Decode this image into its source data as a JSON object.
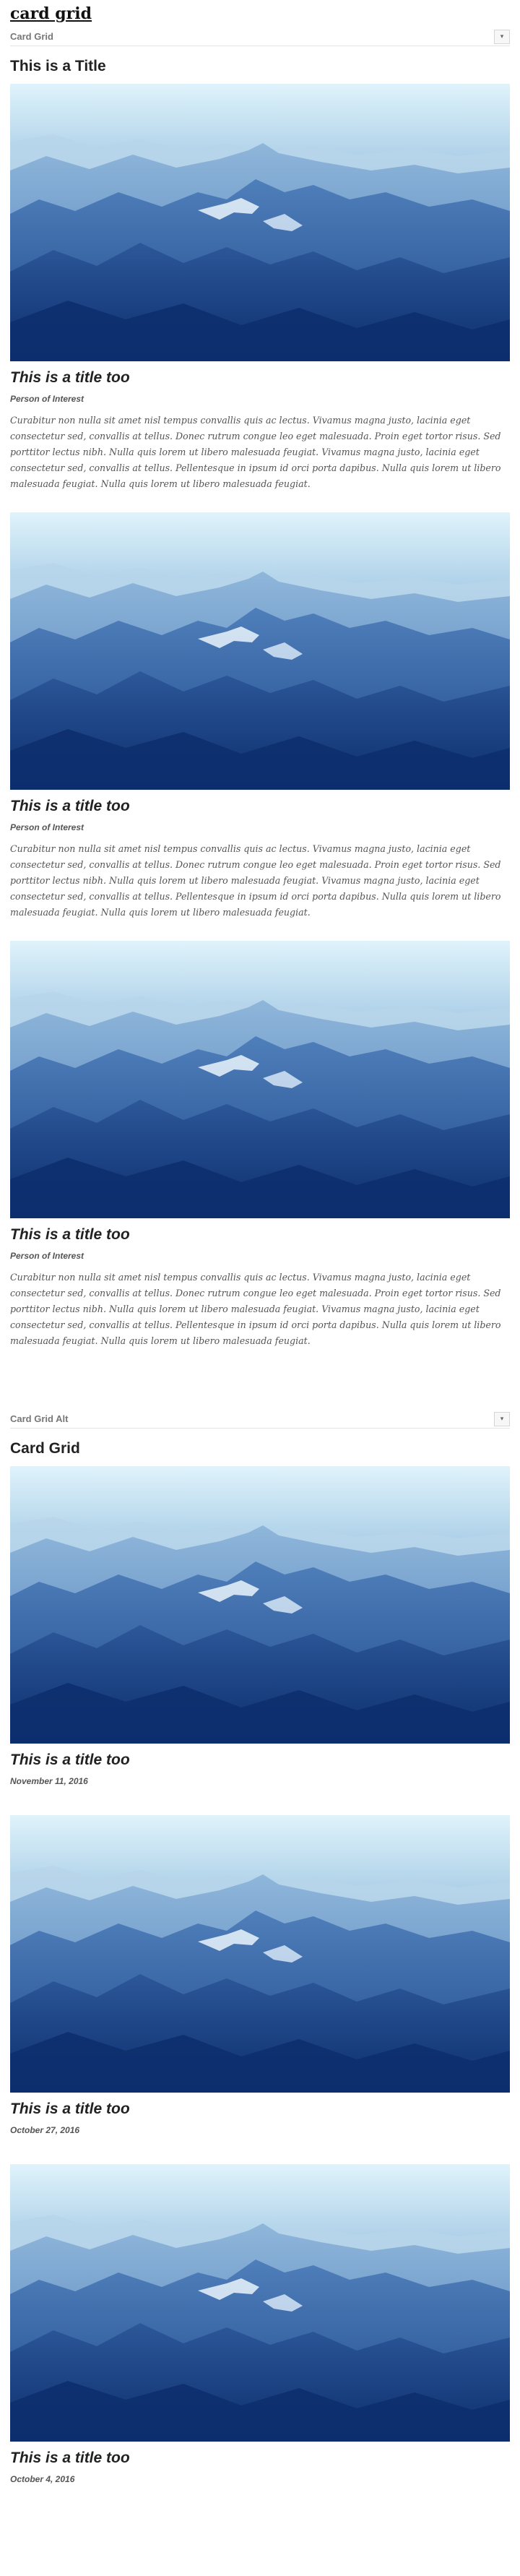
{
  "page": {
    "title": "card grid"
  },
  "section1": {
    "header_label": "Card Grid",
    "toggle_icon": "▾",
    "title": "This is a Title",
    "cards": [
      {
        "title": "This is a title too",
        "meta": "Person of Interest",
        "text": "Curabitur non nulla sit amet nisl tempus convallis quis ac lectus. Vivamus magna justo, lacinia eget consectetur sed, convallis at tellus. Donec rutrum congue leo eget malesuada. Proin eget tortor risus. Sed porttitor lectus nibh. Nulla quis lorem ut libero malesuada feugiat. Vivamus magna justo, lacinia eget consectetur sed, convallis at tellus. Pellentesque in ipsum id orci porta dapibus. Nulla quis lorem ut libero malesuada feugiat. Nulla quis lorem ut libero malesuada feugiat."
      },
      {
        "title": "This is a title too",
        "meta": "Person of Interest",
        "text": "Curabitur non nulla sit amet nisl tempus convallis quis ac lectus. Vivamus magna justo, lacinia eget consectetur sed, convallis at tellus. Donec rutrum congue leo eget malesuada. Proin eget tortor risus. Sed porttitor lectus nibh. Nulla quis lorem ut libero malesuada feugiat. Vivamus magna justo, lacinia eget consectetur sed, convallis at tellus. Pellentesque in ipsum id orci porta dapibus. Nulla quis lorem ut libero malesuada feugiat. Nulla quis lorem ut libero malesuada feugiat."
      },
      {
        "title": "This is a title too",
        "meta": "Person of Interest",
        "text": "Curabitur non nulla sit amet nisl tempus convallis quis ac lectus. Vivamus magna justo, lacinia eget consectetur sed, convallis at tellus. Donec rutrum congue leo eget malesuada. Proin eget tortor risus. Sed porttitor lectus nibh. Nulla quis lorem ut libero malesuada feugiat. Vivamus magna justo, lacinia eget consectetur sed, convallis at tellus. Pellentesque in ipsum id orci porta dapibus. Nulla quis lorem ut libero malesuada feugiat. Nulla quis lorem ut libero malesuada feugiat."
      }
    ]
  },
  "section2": {
    "header_label": "Card Grid Alt",
    "toggle_icon": "▾",
    "title": "Card Grid",
    "cards": [
      {
        "title": "This is a title too",
        "meta": "November 11, 2016"
      },
      {
        "title": "This is a title too",
        "meta": "October 27, 2016"
      },
      {
        "title": "This is a title too",
        "meta": "October 4, 2016"
      }
    ]
  },
  "colors": {
    "sky_top": "#dff3fb",
    "mountain_dark": "#0d2f6e",
    "accent_text": "#555555"
  },
  "image": {
    "icon": "mountain-landscape-image"
  }
}
